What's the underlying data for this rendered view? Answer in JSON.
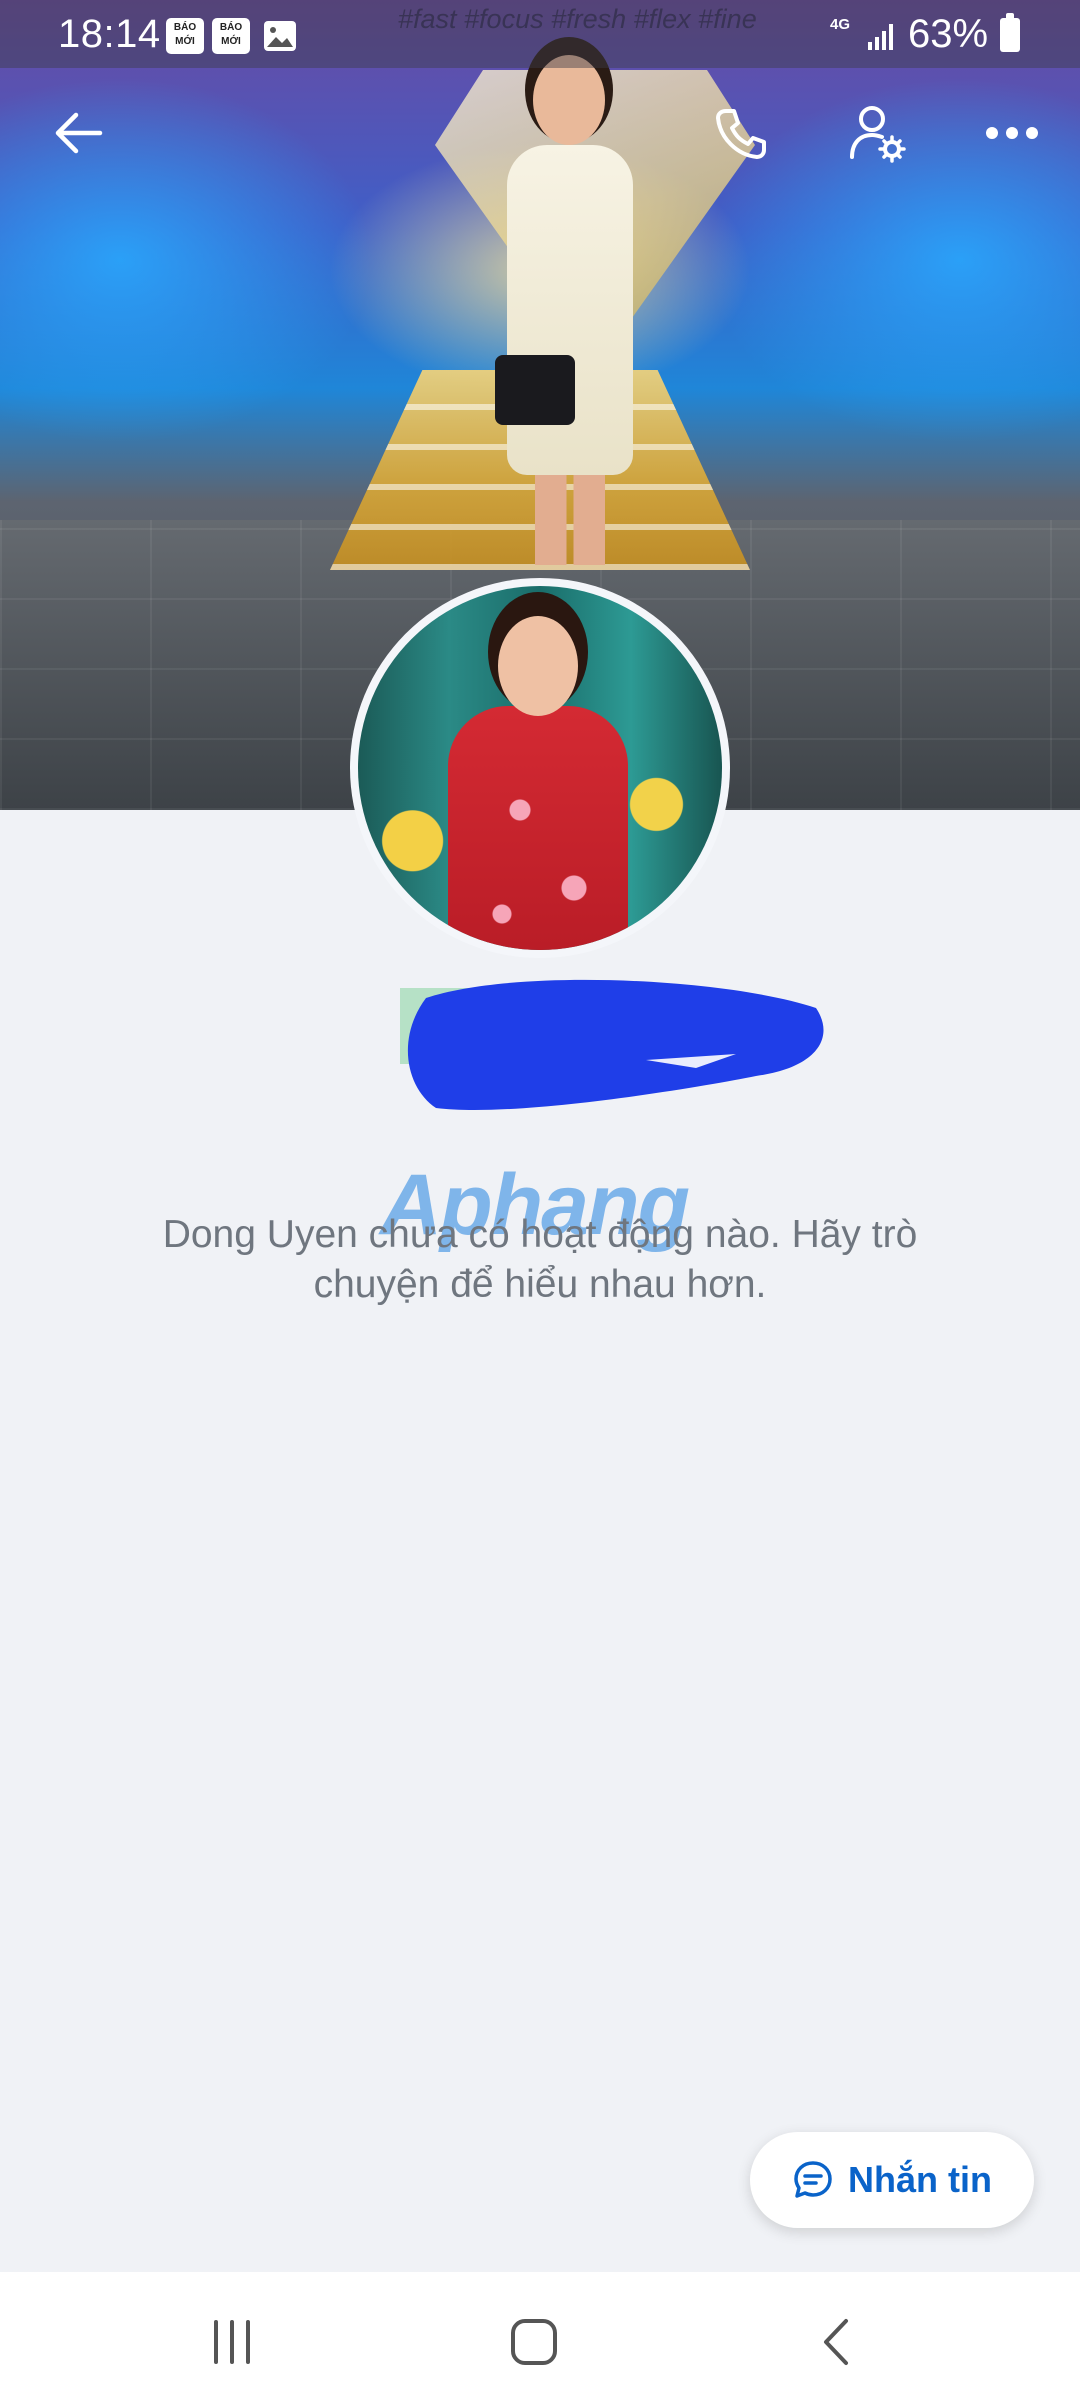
{
  "status_bar": {
    "time": "18:14",
    "badge_1": "BÁO MỚI",
    "badge_2": "BÁO MỚI",
    "network": "4G",
    "battery": "63%"
  },
  "cover_hashtags": "#fast #focus #fresh #flex #fine",
  "icons": {
    "back": "back-arrow-icon",
    "call": "phone-icon",
    "profile_settings": "user-settings-icon",
    "more": "more-dots-icon",
    "message": "chat-bubble-icon",
    "nav_recents": "recents-icon",
    "nav_home": "home-icon",
    "nav_back": "chevron-left-icon"
  },
  "watermark": "Aphang",
  "profile": {
    "empty_message": "Dong Uyen chưa có hoạt động nào. Hãy trò chuyện để hiểu nhau hơn."
  },
  "actions": {
    "message_label": "Nhắn tin"
  },
  "colors": {
    "accent": "#0a63c9",
    "background": "#f0f2f6",
    "redaction": "#1f3ee8"
  }
}
